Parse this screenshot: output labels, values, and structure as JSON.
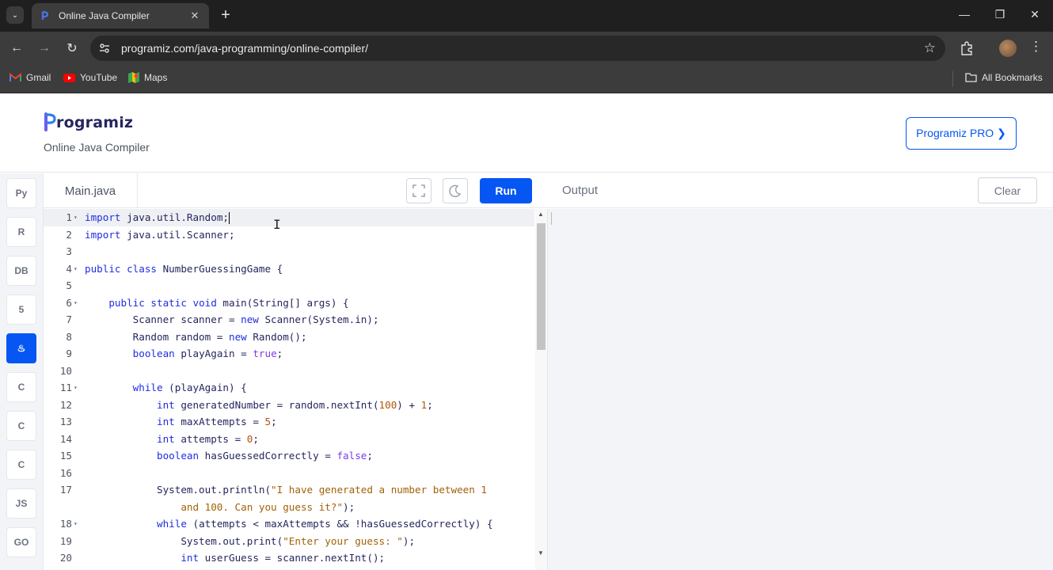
{
  "browser": {
    "tab_title": "Online Java Compiler",
    "url": "programiz.com/java-programming/online-compiler/",
    "bookmarks": [
      {
        "label": "Gmail",
        "icon": "gmail-icon"
      },
      {
        "label": "YouTube",
        "icon": "youtube-icon"
      },
      {
        "label": "Maps",
        "icon": "maps-icon"
      }
    ],
    "all_bookmarks_label": "All Bookmarks"
  },
  "header": {
    "logo_text": "rogramiz",
    "subtitle": "Online Java Compiler",
    "pro_button": "Programiz PRO ❯"
  },
  "sidebar": {
    "languages": [
      {
        "name": "python-icon",
        "glyph": "Py",
        "active": false
      },
      {
        "name": "r-icon",
        "glyph": "R",
        "active": false
      },
      {
        "name": "sql-icon",
        "glyph": "DB",
        "active": false
      },
      {
        "name": "html-icon",
        "glyph": "5",
        "active": false
      },
      {
        "name": "java-icon",
        "glyph": "♨",
        "active": true
      },
      {
        "name": "c-icon",
        "glyph": "C",
        "active": false
      },
      {
        "name": "cpp-icon",
        "glyph": "C",
        "active": false
      },
      {
        "name": "csharp-icon",
        "glyph": "C",
        "active": false
      },
      {
        "name": "javascript-icon",
        "glyph": "JS",
        "active": false
      },
      {
        "name": "go-icon",
        "glyph": "GO",
        "active": false
      }
    ]
  },
  "editor": {
    "file_name": "Main.java",
    "run_label": "Run",
    "lines": [
      {
        "n": "1",
        "fold": true,
        "html": "<span class='kw'>import</span> java.util.Random;"
      },
      {
        "n": "2",
        "fold": false,
        "html": "<span class='kw'>import</span> java.util.Scanner;"
      },
      {
        "n": "3",
        "fold": false,
        "html": ""
      },
      {
        "n": "4",
        "fold": true,
        "html": "<span class='kw'>public class</span> NumberGuessingGame {"
      },
      {
        "n": "5",
        "fold": false,
        "html": ""
      },
      {
        "n": "6",
        "fold": true,
        "html": "    <span class='kw'>public static void</span> main(String[] args) {"
      },
      {
        "n": "7",
        "fold": false,
        "html": "        Scanner scanner = <span class='kw'>new</span> Scanner(System.in);"
      },
      {
        "n": "8",
        "fold": false,
        "html": "        Random random = <span class='kw'>new</span> Random();"
      },
      {
        "n": "9",
        "fold": false,
        "html": "        <span class='kw'>boolean</span> playAgain = <span class='lit'>true</span>;"
      },
      {
        "n": "10",
        "fold": false,
        "html": ""
      },
      {
        "n": "11",
        "fold": true,
        "html": "        <span class='kw'>while</span> (playAgain) {"
      },
      {
        "n": "12",
        "fold": false,
        "html": "            <span class='kw'>int</span> generatedNumber = random.nextInt(<span class='num'>100</span>) + <span class='num'>1</span>;"
      },
      {
        "n": "13",
        "fold": false,
        "html": "            <span class='kw'>int</span> maxAttempts = <span class='num'>5</span>;"
      },
      {
        "n": "14",
        "fold": false,
        "html": "            <span class='kw'>int</span> attempts = <span class='num'>0</span>;"
      },
      {
        "n": "15",
        "fold": false,
        "html": "            <span class='kw'>boolean</span> hasGuessedCorrectly = <span class='lit'>false</span>;"
      },
      {
        "n": "16",
        "fold": false,
        "html": ""
      },
      {
        "n": "17",
        "fold": false,
        "html": "            System.out.println(<span class='str'>\"I have generated a number between 1</span>"
      },
      {
        "n": "",
        "fold": false,
        "html": "<span class='str'>                and 100. Can you guess it?\"</span>);"
      },
      {
        "n": "18",
        "fold": true,
        "html": "            <span class='kw'>while</span> (attempts &lt; maxAttempts &amp;&amp; !hasGuessedCorrectly) {"
      },
      {
        "n": "19",
        "fold": false,
        "html": "                System.out.print(<span class='str'>\"Enter your guess: \"</span>);"
      },
      {
        "n": "20",
        "fold": false,
        "html": "                <span class='kw'>int</span> userGuess = scanner.nextInt();"
      }
    ]
  },
  "output": {
    "title": "Output",
    "clear_label": "Clear",
    "content": ""
  }
}
